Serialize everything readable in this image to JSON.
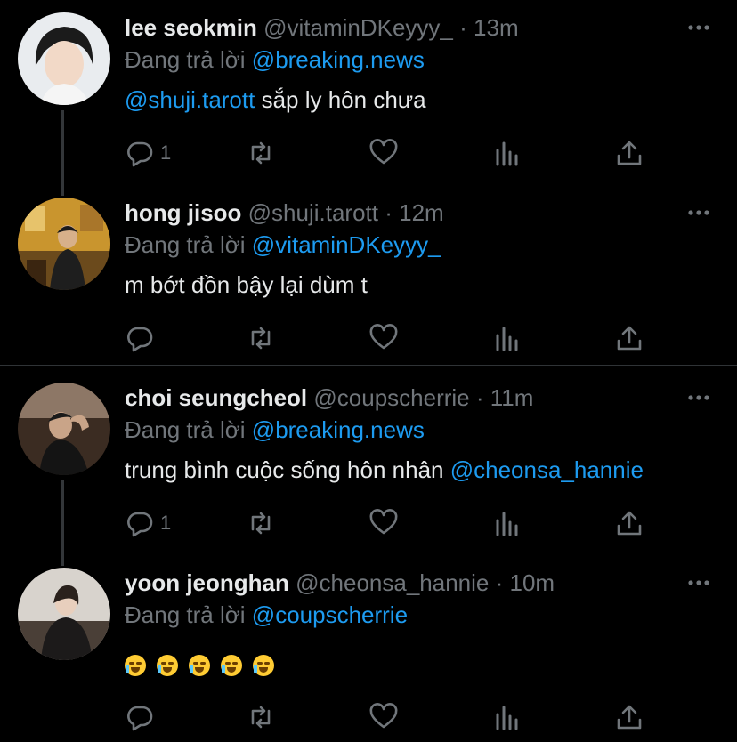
{
  "tweets": [
    {
      "name": "lee seokmin",
      "handle": "@vitaminDKeyyy_",
      "dot": "·",
      "time": "13m",
      "replying_prefix": "Đang trả lời",
      "replying_to": "@breaking.news",
      "body_mention": "@shuji.tarott",
      "body_text": " sắp ly hôn chưa",
      "reply_count": "1",
      "avatar_icon": "avatar-photo"
    },
    {
      "name": "hong jisoo",
      "handle": "@shuji.tarott",
      "dot": "·",
      "time": "12m",
      "replying_prefix": "Đang trả lời",
      "replying_to": "@vitaminDKeyyy_",
      "body_mention": "",
      "body_text": "m bớt đồn bậy lại dùm t",
      "reply_count": "",
      "avatar_icon": "avatar-photo"
    },
    {
      "name": "choi seungcheol",
      "handle": "@coupscherrie",
      "dot": "·",
      "time": "11m",
      "replying_prefix": "Đang trả lời",
      "replying_to": "@breaking.news",
      "body_text": "trung bình cuộc sống hôn nhân ",
      "body_mention": "@cheonsa_hannie",
      "reply_count": "1",
      "avatar_icon": "avatar-photo"
    },
    {
      "name": "yoon jeonghan",
      "handle": "@cheonsa_hannie",
      "dot": "·",
      "time": "10m",
      "replying_prefix": "Đang trả lời",
      "replying_to": "@coupscherrie",
      "body_emoji": [
        "😭",
        "😭",
        "😭",
        "😭",
        "😭"
      ],
      "reply_count": "",
      "avatar_icon": "avatar-photo"
    }
  ],
  "icons": {
    "reply": "reply-icon",
    "retweet": "retweet-icon",
    "like": "heart-icon",
    "views": "analytics-icon",
    "share": "share-icon",
    "more": "more-icon"
  },
  "colors": {
    "background": "#000000",
    "text": "#e7e9ea",
    "muted": "#71767b",
    "accent": "#1d9bf0",
    "divider": "#2f3336"
  }
}
